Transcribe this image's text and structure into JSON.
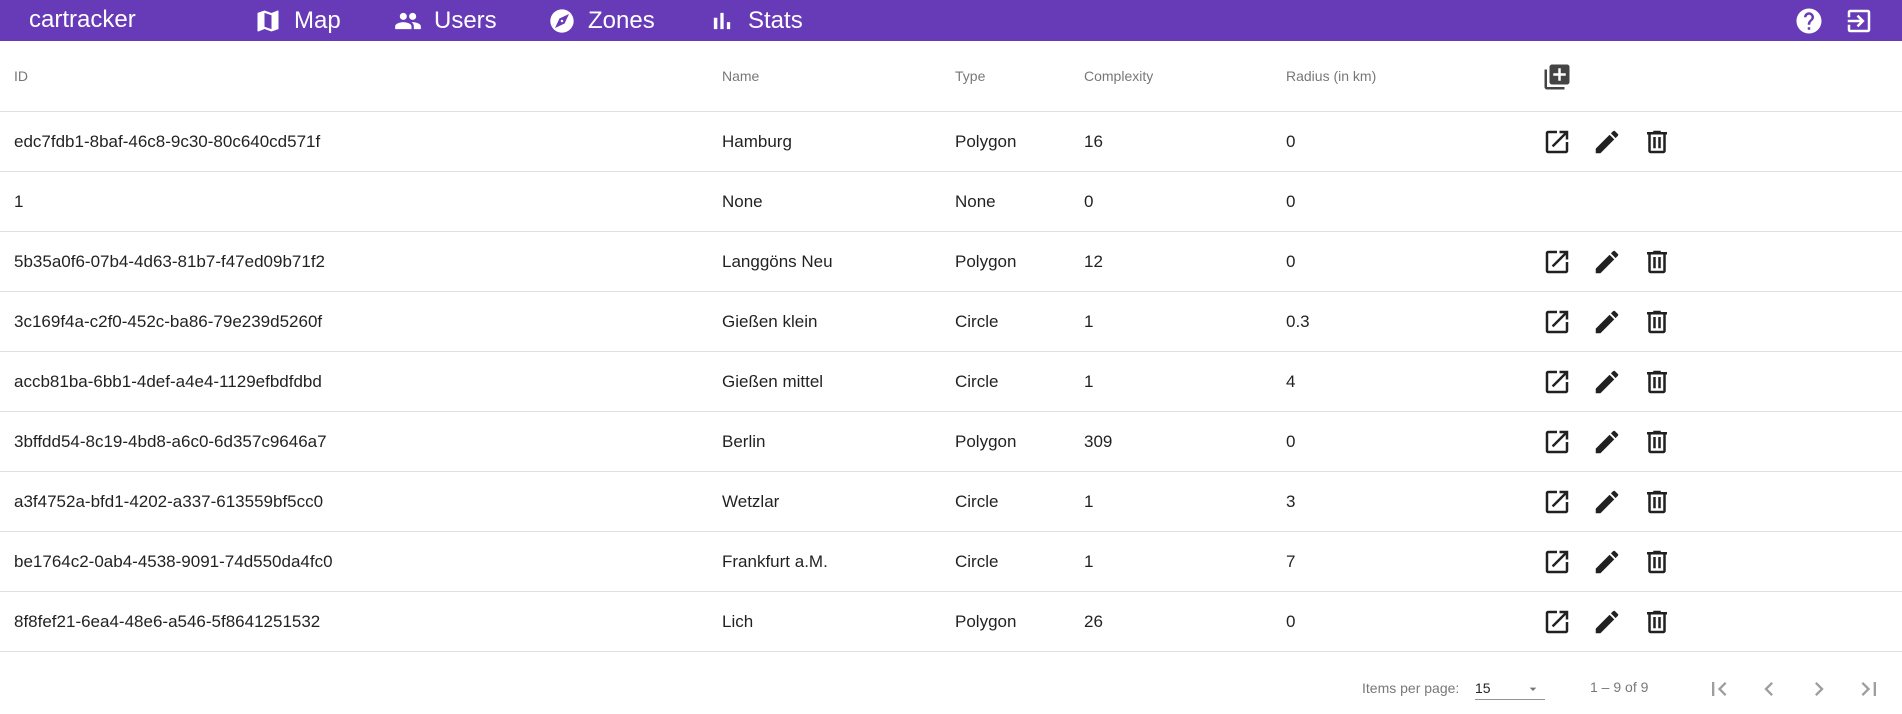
{
  "colors": {
    "toolbar_bg": "#673ab7",
    "toolbar_text": "#ffffff",
    "divider": "#e0e0e0"
  },
  "toolbar": {
    "brand": "cartracker",
    "nav": [
      {
        "label": "Map",
        "icon": "map-icon"
      },
      {
        "label": "Users",
        "icon": "people-icon"
      },
      {
        "label": "Zones",
        "icon": "compass-icon"
      },
      {
        "label": "Stats",
        "icon": "bar-chart-icon"
      }
    ],
    "right_icons": [
      "help-icon",
      "logout-icon"
    ]
  },
  "table": {
    "columns": [
      "ID",
      "Name",
      "Type",
      "Complexity",
      "Radius (in km)"
    ],
    "header_action_icon": "library-add-icon",
    "row_action_icons": [
      "open-in-new-icon",
      "edit-pencil-icon",
      "delete-trash-icon"
    ],
    "rows": [
      {
        "id": "edc7fdb1-8baf-46c8-9c30-80c640cd571f",
        "name": "Hamburg",
        "type": "Polygon",
        "complexity": "16",
        "radius": "0",
        "has_actions": true
      },
      {
        "id": "1",
        "name": "None",
        "type": "None",
        "complexity": "0",
        "radius": "0",
        "has_actions": false
      },
      {
        "id": "5b35a0f6-07b4-4d63-81b7-f47ed09b71f2",
        "name": "Langgöns Neu",
        "type": "Polygon",
        "complexity": "12",
        "radius": "0",
        "has_actions": true
      },
      {
        "id": "3c169f4a-c2f0-452c-ba86-79e239d5260f",
        "name": "Gießen klein",
        "type": "Circle",
        "complexity": "1",
        "radius": "0.3",
        "has_actions": true
      },
      {
        "id": "accb81ba-6bb1-4def-a4e4-1129efbdfdbd",
        "name": "Gießen mittel",
        "type": "Circle",
        "complexity": "1",
        "radius": "4",
        "has_actions": true
      },
      {
        "id": "3bffdd54-8c19-4bd8-a6c0-6d357c9646a7",
        "name": "Berlin",
        "type": "Polygon",
        "complexity": "309",
        "radius": "0",
        "has_actions": true
      },
      {
        "id": "a3f4752a-bfd1-4202-a337-613559bf5cc0",
        "name": "Wetzlar",
        "type": "Circle",
        "complexity": "1",
        "radius": "3",
        "has_actions": true
      },
      {
        "id": "be1764c2-0ab4-4538-9091-74d550da4fc0",
        "name": "Frankfurt a.M.",
        "type": "Circle",
        "complexity": "1",
        "radius": "7",
        "has_actions": true
      },
      {
        "id": "8f8fef21-6ea4-48e6-a546-5f8641251532",
        "name": "Lich",
        "type": "Polygon",
        "complexity": "26",
        "radius": "0",
        "has_actions": true
      }
    ]
  },
  "paginator": {
    "items_per_page_label": "Items per page:",
    "items_per_page_value": "15",
    "range_label": "1 – 9 of 9",
    "buttons": [
      "first-page-icon",
      "prev-page-icon",
      "next-page-icon",
      "last-page-icon"
    ]
  }
}
